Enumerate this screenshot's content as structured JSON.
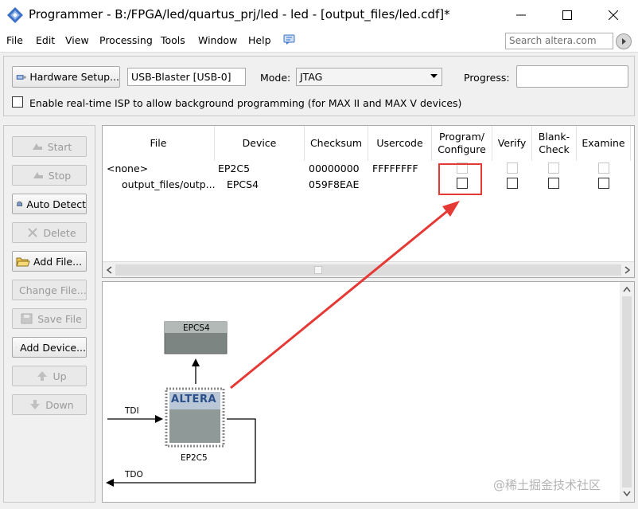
{
  "window": {
    "title": "Programmer - B:/FPGA/led/quartus_prj/led - led - [output_files/led.cdf]*"
  },
  "menu": {
    "items": [
      "File",
      "Edit",
      "View",
      "Processing",
      "Tools",
      "Window",
      "Help"
    ],
    "search_placeholder": "Search altera.com"
  },
  "toolbar": {
    "hardware_setup": "Hardware Setup...",
    "hardware_value": "USB-Blaster [USB-0]",
    "mode_label": "Mode:",
    "mode_value": "JTAG",
    "progress_label": "Progress:",
    "isp_label": "Enable real-time ISP to allow background programming (for MAX II and MAX V devices)"
  },
  "side_buttons": {
    "start": "Start",
    "stop": "Stop",
    "auto_detect": "Auto Detect",
    "delete": "Delete",
    "add_file": "Add File...",
    "change_file": "Change File...",
    "save_file": "Save File",
    "add_device": "Add Device...",
    "up": "Up",
    "down": "Down"
  },
  "table": {
    "headers": {
      "file": "File",
      "device": "Device",
      "checksum": "Checksum",
      "usercode": "Usercode",
      "program_line1": "Program/",
      "program_line2": "Configure",
      "verify": "Verify",
      "blank_line1": "Blank-",
      "blank_line2": "Check",
      "examine": "Examine"
    },
    "rows": [
      {
        "file": "<none>",
        "device": "EP2C5",
        "checksum": "00000000",
        "usercode": "FFFFFFFF"
      },
      {
        "file": "output_files/outp...",
        "device": "EPCS4",
        "checksum": "059F8EAE",
        "usercode": ""
      }
    ]
  },
  "diagram": {
    "epcs_label": "EPCS4",
    "chip_logo": "ALTERA",
    "chip_name": "EP2C5",
    "tdi_label": "TDI",
    "tdo_label": "TDO"
  },
  "watermark": "@稀土掘金技术社区",
  "colors": {
    "annotation": "#e53935",
    "titlebar": "#ffffff",
    "panel": "#f0f0f0"
  }
}
